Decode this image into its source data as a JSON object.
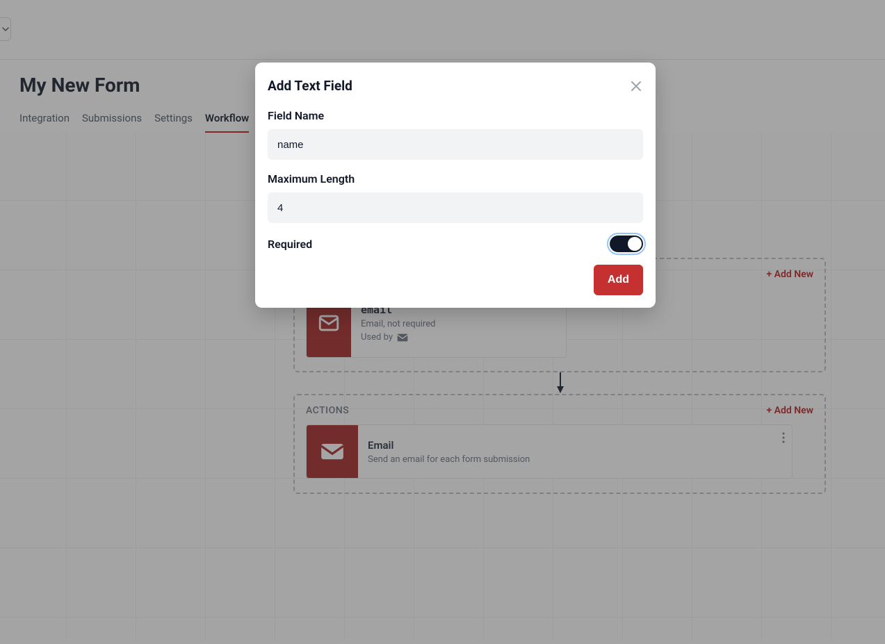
{
  "page": {
    "title": "My New Form"
  },
  "tabs": {
    "items": [
      {
        "label": "Integration",
        "active": false
      },
      {
        "label": "Submissions",
        "active": false
      },
      {
        "label": "Settings",
        "active": false
      },
      {
        "label": "Workflow",
        "active": true
      }
    ]
  },
  "workflow": {
    "fields": {
      "section_label": "",
      "add_new_label": "+ Add New",
      "card": {
        "name": "email",
        "description": "Email, not required",
        "used_by_label": "Used by"
      }
    },
    "actions": {
      "section_label": "ACTIONS",
      "add_new_label": "+ Add New",
      "card": {
        "title": "Email",
        "description": "Send an email for each form submission"
      }
    }
  },
  "modal": {
    "title": "Add Text Field",
    "field_name_label": "Field Name",
    "field_name_value": "name",
    "max_length_label": "Maximum Length",
    "max_length_value": "4",
    "required_label": "Required",
    "required_value": true,
    "submit_label": "Add"
  }
}
